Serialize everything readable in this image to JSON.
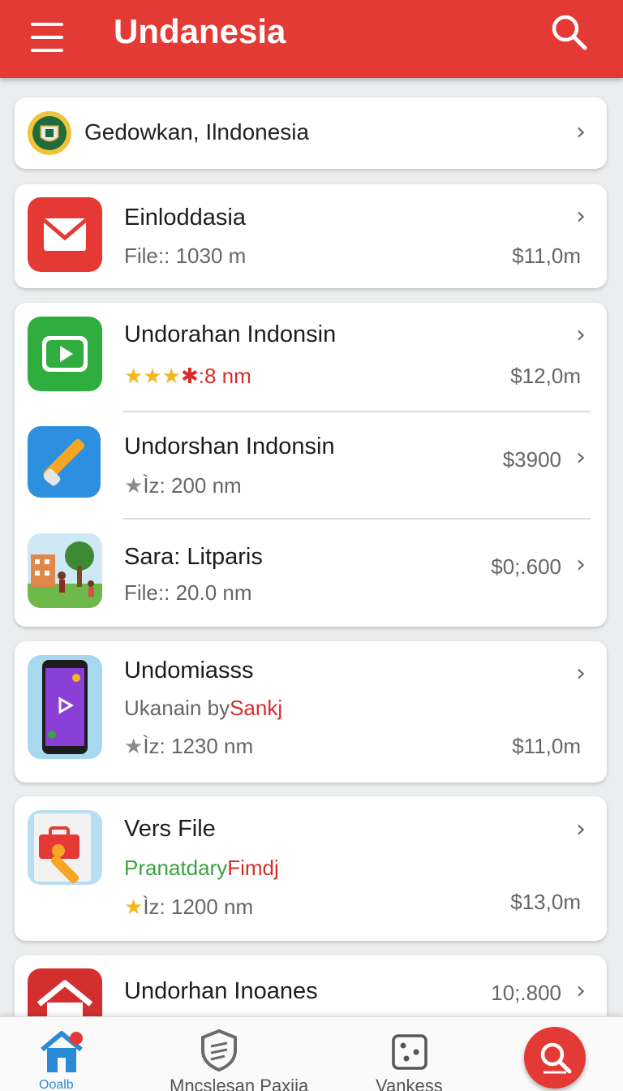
{
  "appbar": {
    "title": "Undanesia",
    "menu_icon": "hamburger-menu-icon",
    "search_icon": "search-icon"
  },
  "location": {
    "text": "Gedowkan, Ilndonesia",
    "icon": "crest-badge-icon"
  },
  "items": [
    {
      "title": "Einloddasia",
      "line2": "File:: 1030 m",
      "price": "$11,0m",
      "icon": "mail-envelope-icon"
    },
    {
      "title": "Undorahan Indonsin",
      "stars_text": "★★★",
      "rating_text": "✱:8 nm",
      "price": "$12,0m",
      "icon": "play-video-icon"
    },
    {
      "title": "Undorshan Indonsin",
      "star": "★",
      "rating_text": "Ìz: 200 nm",
      "price": "$3900",
      "icon": "pencil-icon"
    },
    {
      "title": "Sara: Litparis",
      "line2": "File:: 20.0 nm",
      "price": "$0;.600",
      "icon": "village-illustration-icon"
    },
    {
      "title": "Undomiasss",
      "author_prefix": "Ukanain by",
      "author_name": "Sankj",
      "star": "★",
      "rating_text": "Ìz: 1230 nm",
      "price": "$11,0m",
      "icon": "smartphone-icon"
    },
    {
      "title": "Vers File",
      "sub_green": "Pranatdary",
      "sub_red": "Fimdj",
      "star": "★",
      "rating_text": "Ìz: 1200 nm",
      "price": "$13,0m",
      "icon": "toolbox-icon"
    },
    {
      "title": "Undorhan Inoanes",
      "price": "10;.800",
      "icon": "home-app-icon"
    }
  ],
  "chevron": "›",
  "bottom_nav": [
    {
      "label": "Ooalb",
      "icon": "home-icon"
    },
    {
      "label": "Mncslesan Paxija",
      "icon": "shield-icon"
    },
    {
      "label": "Vankess",
      "icon": "dice-icon"
    }
  ],
  "fab_icon": "search-icon",
  "colors": {
    "accent": "#e33a36",
    "background": "#ebedee",
    "card": "#ffffff",
    "star": "#f2b81d"
  }
}
